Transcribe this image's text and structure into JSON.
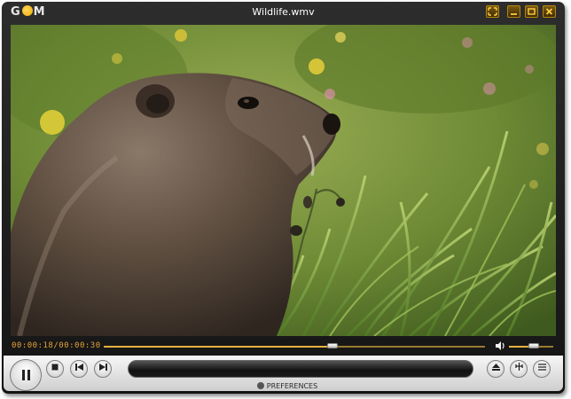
{
  "app": {
    "logo": "GOM",
    "title": "Wildlife.wmv"
  },
  "window_controls": {
    "icons": [
      "fullscreen-icon",
      "minimize-icon",
      "maximize-icon",
      "close-icon"
    ]
  },
  "playback": {
    "time_display": "00:00:18/00:00:30",
    "position_fraction": 0.6,
    "volume_fraction": 0.55
  },
  "controls": {
    "icons": [
      "pause-icon",
      "stop-icon",
      "previous-icon",
      "next-icon",
      "open-file-icon",
      "equalizer-icon",
      "playlist-icon"
    ],
    "preferences_label": "PREFERENCES"
  },
  "colors": {
    "accent": "#e6a33a",
    "chrome": "#1e1e1e",
    "control_bar": "#e0e0e0"
  }
}
